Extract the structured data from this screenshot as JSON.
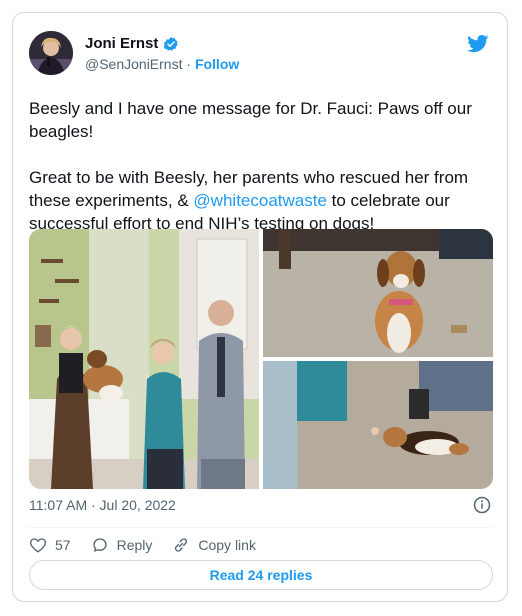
{
  "author": {
    "name": "Joni Ernst",
    "handle": "@SenJoniErnst",
    "separator": "·",
    "follow_label": "Follow"
  },
  "tweet": {
    "paragraph1": "Beesly and I have one message for Dr. Fauci: Paws off our beagles!",
    "p2_before": "Great to be with Beesly, her parents who rescued her from these experiments, & ",
    "p2_mention": "@whitecoatwaste",
    "p2_after": " to celebrate our successful effort to end NIH’s testing on dogs!"
  },
  "meta": {
    "timestamp": "11:07 AM · Jul 20, 2022"
  },
  "actions": {
    "like_count": "57",
    "reply_label": "Reply",
    "copy_label": "Copy link"
  },
  "read_replies_label": "Read 24 replies",
  "colors": {
    "accent": "#1d9bf0",
    "muted": "#536471",
    "border": "#cfd9de"
  },
  "icons": [
    "verified-badge-icon",
    "twitter-bird-icon",
    "info-icon",
    "heart-icon",
    "reply-bubble-icon",
    "link-icon"
  ]
}
